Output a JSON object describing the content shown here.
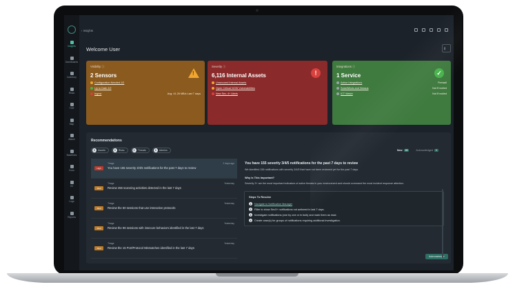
{
  "breadcrumb": "Insights",
  "sidebar": {
    "items": [
      {
        "label": "Insights",
        "icon": "insights-icon"
      },
      {
        "label": "Dashboards",
        "icon": "dashboard-icon"
      },
      {
        "label": "Inventory",
        "icon": "inventory-icon"
      },
      {
        "label": "Risks",
        "icon": "risks-icon"
      },
      {
        "label": "TDR",
        "icon": "tdr-icon"
      },
      {
        "label": "Map",
        "icon": "map-icon"
      },
      {
        "label": "Attack",
        "icon": "attack-icon"
      },
      {
        "label": "Baselines",
        "icon": "baselines-icon"
      },
      {
        "label": "Docs",
        "icon": "docs-icon"
      },
      {
        "label": "XV",
        "icon": "xv-icon"
      },
      {
        "label": "Logs",
        "icon": "logs-icon"
      },
      {
        "label": "Reports",
        "icon": "reports-icon"
      }
    ]
  },
  "welcome": "Welcome User",
  "cards": {
    "visibility": {
      "label": "Visibility ⓘ",
      "value": "2 Sensors",
      "rows": [
        {
          "text": "Configuration Needed 1/2",
          "dot": "#f0a630"
        },
        {
          "text": "Up to Date 2/2",
          "dot": "#48b34c"
        },
        {
          "text": "Ingest",
          "dot": "#d8413e",
          "right": "Avg: 41.26 MB/s Last 7 days"
        }
      ]
    },
    "severity": {
      "label": "Severity ⓘ",
      "value": "6,116 Internal Assets",
      "rows": [
        {
          "text": "Unsecured Internal Assets",
          "dot": "#f0a630"
        },
        {
          "text": "Open Critical NOW Vulnerabilities",
          "dot": "#f0a630"
        },
        {
          "text": "New Sev. 4+ Alerts",
          "dot": "#d8413e"
        }
      ]
    },
    "integrations": {
      "label": "Integrations ⓘ",
      "value": "1 Service",
      "rows": [
        {
          "text": "Active Integrations",
          "dot": "#9aa4ab",
          "right": "Firewall"
        },
        {
          "text": "SolarWinds and Nessus",
          "dot": "#9aa4ab",
          "right": "Not Enrolled"
        },
        {
          "text": "ICT Watch",
          "dot": "#9aa4ab",
          "right": "Not Enrolled"
        }
      ]
    }
  },
  "recommendations": {
    "title": "Recommendations",
    "filters": [
      {
        "count": "0",
        "label": "Assets"
      },
      {
        "count": "0",
        "label": "Risks"
      },
      {
        "count": "0",
        "label": "Threats"
      },
      {
        "count": "0",
        "label": "Admins"
      }
    ],
    "tabs": [
      {
        "label": "New",
        "count": "25"
      },
      {
        "label": "Acknowledged",
        "count": "0"
      }
    ],
    "items": [
      {
        "sev": "High",
        "stage": "Triage",
        "msg": "You have 155 severity 3/4/5 notifications for the past 7 days to review",
        "when": "2 days ago",
        "color": "#c0392b"
      },
      {
        "sev": "Med",
        "stage": "Triage",
        "msg": "Review 456 scanning activities detected in the last 7 days",
        "when": "Yesterday",
        "color": "#c07a25"
      },
      {
        "sev": "Med",
        "stage": "Triage",
        "msg": "Review the 60 sessions that use interactive protocols",
        "when": "Yesterday",
        "color": "#c07a25"
      },
      {
        "sev": "Med",
        "stage": "Triage",
        "msg": "Review the 96 sessions with insecure behaviors identified in the last 7 days",
        "when": "Yesterday",
        "color": "#c07a25"
      },
      {
        "sev": "Med",
        "stage": "Triage",
        "msg": "Review the 15 Port/Protocol Mismatches identified in the last 7 days",
        "when": "Yesterday",
        "color": "#c07a25"
      }
    ],
    "detail": {
      "title": "You have 155 severity 3/4/5 notifications for the past 7 days to review",
      "desc": "We identified 155 notifications with severity 3/4/5 that have not been reviewed yet for the past 7 days.",
      "why_title": "Why Is This Important?",
      "why_text": "Severity 3+ are the most important indicators of active threats in your environment and should command the most incident response attention.",
      "steps_title": "Steps To Resolve",
      "steps": [
        {
          "n": "1",
          "text": "Navigate to Notification Manager",
          "link": true
        },
        {
          "n": "2",
          "text": "Filter to show Sev3+ notifications not actioned in last 7 days.",
          "link": false
        },
        {
          "n": "3",
          "text": "Investigate notifications (one by one or in bulk) and mark them as read.",
          "link": false
        },
        {
          "n": "4",
          "text": "Create case(s) for groups of notifications requiring additional investigation.",
          "link": false
        }
      ],
      "ack_label": "Acknowledge"
    }
  }
}
